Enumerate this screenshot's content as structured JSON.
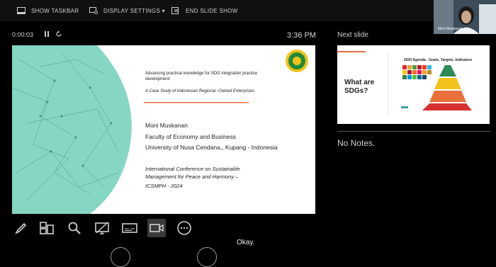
{
  "toolbar": {
    "show_taskbar": "SHOW TASKBAR",
    "display_settings": "DISPLAY SETTINGS ▾",
    "end_slide_show": "END SLIDE SHOW"
  },
  "presenter": {
    "elapsed_time": "0:00:03",
    "current_time": "3:36 PM",
    "next_slide_label": "Next slide",
    "notes_text": "No Notes."
  },
  "current_slide": {
    "title": "Advancing practical knowledge for SDG integration practice",
    "title_line2": "development",
    "subtitle": "A Case Study of Indonesian Regional -Owned Enterprises",
    "author": "Moni Muskanan",
    "faculty": "Faculty of Economy and Business",
    "university": "University of Nusa Cendana,, Kupang - Indonesia",
    "conference_line1": "International Conference on Sustainable",
    "conference_line2": "Management for Peace and Harmony –",
    "conference_line3": "ICSMPH - 2024"
  },
  "next_slide": {
    "title_line1": "What are",
    "title_line2": "SDGs?",
    "agenda_title": "2030 Agenda : Goals, Targets, Indicators"
  },
  "webcam": {
    "name_tag": "Moni Muskanan / iko"
  },
  "caption": "Okay.",
  "colors": {
    "slide_accent": "#e8703a",
    "teal": "#7fd4c1",
    "logo_green": "#1f8a3a",
    "logo_yellow": "#f2c21b"
  }
}
